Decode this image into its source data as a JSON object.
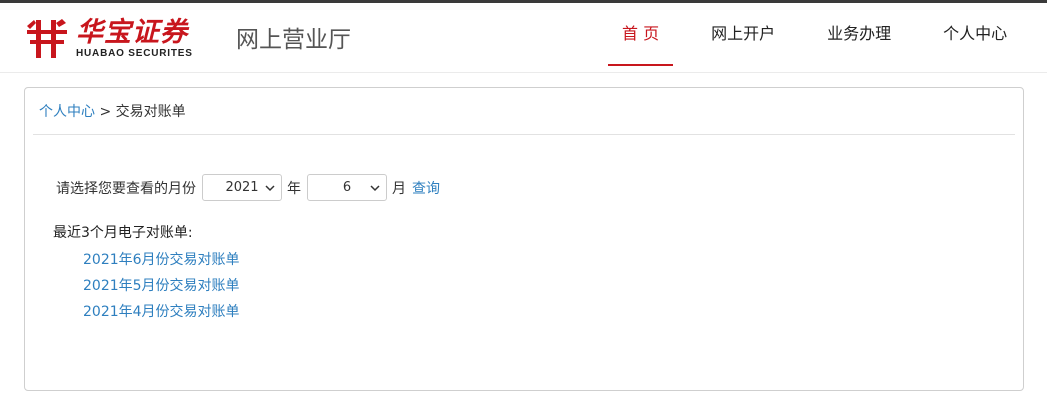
{
  "brand": {
    "logo_cn": "华宝证券",
    "logo_en": "HUABAO SECURITES",
    "portal_title": "网上营业厅",
    "brand_color": "#c8161d"
  },
  "nav": {
    "items": [
      {
        "label": "首 页",
        "active": true
      },
      {
        "label": "网上开户",
        "active": false
      },
      {
        "label": "业务办理",
        "active": false
      },
      {
        "label": "个人中心",
        "active": false
      }
    ]
  },
  "breadcrumb": {
    "parent": "个人中心",
    "separator": ">",
    "current": "交易对账单"
  },
  "query": {
    "prompt": "请选择您要查看的月份",
    "year_value": "2021",
    "year_unit": "年",
    "month_value": "6",
    "month_unit": "月",
    "submit_label": "查询"
  },
  "recent": {
    "title": "最近3个月电子对账单:",
    "statements": [
      "2021年6月份交易对账单",
      "2021年5月份交易对账单",
      "2021年4月份交易对账单"
    ]
  },
  "colors": {
    "link": "#2e7fbf",
    "active_nav": "#c8161d"
  }
}
